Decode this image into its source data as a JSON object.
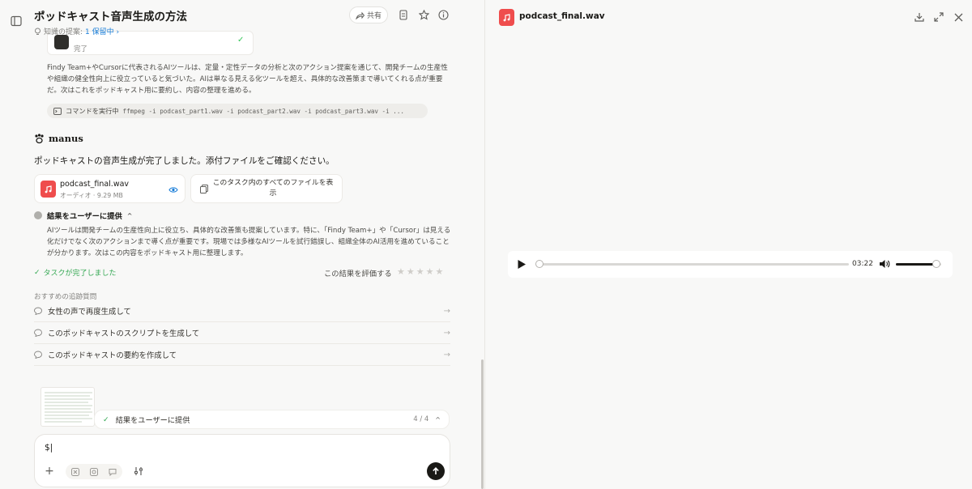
{
  "header": {
    "title": "ポッドキャスト音声生成の方法",
    "suggest_prefix": "知識の提案:",
    "suggest_link": "1 保留中 ›",
    "share_label": "共有"
  },
  "prev_step": {
    "status": "完了"
  },
  "paragraph1": "Findy Team+やCursorに代表されるAIツールは、定量・定性データの分析と次のアクション提案を通じて、開発チームの生産性や組織の健全性向上に役立っていると気づいた。AIは単なる見える化ツールを超え、具体的な改善策まで導いてくれる点が重要だ。次はこれをポッドキャスト用に要約し、内容の整理を進める。",
  "command": {
    "label": "コマンドを実行中",
    "text": "ffmpeg -i podcast_part1.wav -i podcast_part2.wav -i podcast_part3.wav -i ..."
  },
  "manus": {
    "name": "manus",
    "message": "ポッドキャストの音声生成が完了しました。添付ファイルをご確認ください。"
  },
  "attachment": {
    "file_name": "podcast_final.wav",
    "file_meta": "オーディオ · 9.29 MB",
    "view_all_label": "このタスク内のすべてのファイルを表示"
  },
  "result": {
    "heading": "結果をユーザーに提供",
    "paragraph": "AIツールは開発チームの生産性向上に役立ち、具体的な改善策も提案しています。特に、「Findy Team+」や「Cursor」は見える化だけでなく次のアクションまで導く点が重要です。現場では多様なAIツールを試行錯誤し、組織全体のAI活用を進めていることが分かります。次はこの内容をポッドキャスト用に整理します。"
  },
  "task_done": "タスクが完了しました",
  "rate_label": "この結果を評価する",
  "followups": {
    "heading": "おすすめの追跡質問",
    "items": [
      "女性の声で再度生成して",
      "このポッドキャストのスクリプトを生成して",
      "このポッドキャストの要約を作成して"
    ]
  },
  "progress": {
    "label": "結果をユーザーに提供",
    "count": "4 / 4"
  },
  "input": {
    "value": "$|"
  },
  "viewer": {
    "file_name": "podcast_final.wav",
    "time": "03:22",
    "playback_fraction": 0.0,
    "volume_fraction": 0.9
  },
  "colors": {
    "accent_blue": "#1a7ed8",
    "success_green": "#34a853",
    "audio_red": "#ef4d4d"
  }
}
